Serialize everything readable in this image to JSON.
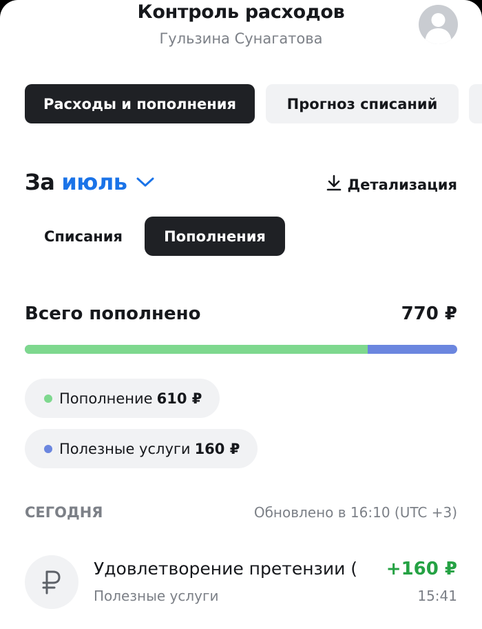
{
  "header": {
    "title": "Контроль расходов",
    "subtitle": "Гульзина Сунагатова"
  },
  "tabs": [
    {
      "label": "Расходы и пополнения",
      "active": true
    },
    {
      "label": "Прогноз списаний",
      "active": false
    }
  ],
  "period": {
    "prefix": "За",
    "month": "июль"
  },
  "details_label": "Детализация",
  "segments": [
    {
      "label": "Списания",
      "active": false
    },
    {
      "label": "Пополнения",
      "active": true
    }
  ],
  "summary": {
    "label": "Всего пополнено",
    "total": "770 ₽",
    "split": [
      {
        "label": "Пополнение",
        "amount": "610 ₽",
        "value": 610,
        "color": "#7ed88e"
      },
      {
        "label": "Полезные услуги",
        "amount": "160 ₽",
        "value": 160,
        "color": "#6b86df"
      }
    ]
  },
  "section": {
    "title": "СЕГОДНЯ",
    "updated": "Обновлено в  16:10 (UTC +3)"
  },
  "transactions": [
    {
      "title": "Удовлетворение претензии (",
      "subtitle": "Полезные услуги",
      "amount": "+160 ₽",
      "time": "15:41",
      "icon": "ruble-icon"
    }
  ],
  "colors": {
    "accent": "#1a73e8",
    "positive": "#25a244",
    "active_tab": "#1f2125"
  }
}
